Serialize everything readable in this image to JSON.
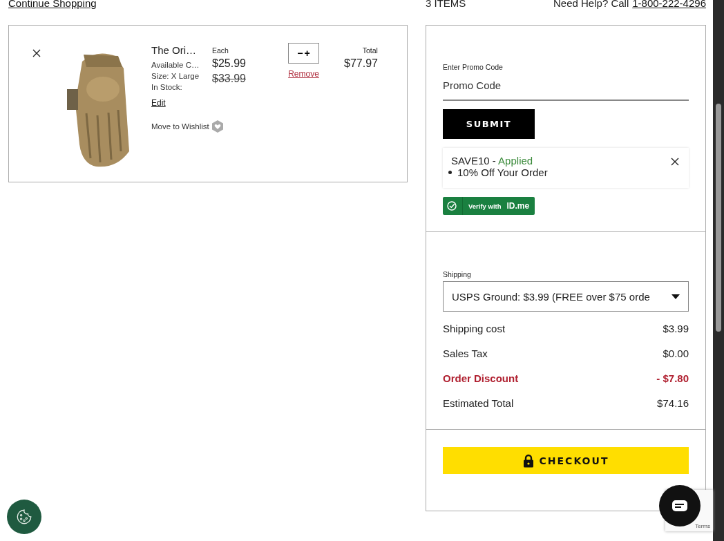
{
  "header": {
    "continue_link": "Continue Shopping",
    "item_count": "3 ITEMS",
    "help_text": "Need Help? Call",
    "phone_link": "1-800-222-4296"
  },
  "cart_items": [
    {
      "name": "The Ori…",
      "available": "Available C…",
      "size": "Size: X Large",
      "stock": "In Stock:",
      "edit": "Edit",
      "wishlist": "Move to Wishlist",
      "each_label": "Each",
      "price": "$25.99",
      "old_price": "$33.99",
      "quantity_minus": "−",
      "quantity_plus": "+",
      "remove": "Remove",
      "total_label": "Total",
      "total": "$77.97"
    }
  ],
  "promo": {
    "label": "Enter Promo Code",
    "placeholder": "Promo Code",
    "submit": "SUBMIT",
    "applied_code": "SAVE10 -",
    "applied_status": "Applied",
    "applied_detail": "10% Off Your Order",
    "verify_text": "Verify with",
    "verify_brand": "ID.me"
  },
  "shipping": {
    "label": "Shipping",
    "selected_option": "USPS Ground: $3.99 (FREE over $75 orde"
  },
  "summary": [
    {
      "label": "Shipping cost",
      "value": "$3.99",
      "kind": "normal"
    },
    {
      "label": "Sales Tax",
      "value": "$0.00",
      "kind": "normal"
    },
    {
      "label": "Order Discount",
      "value": "- $7.80",
      "kind": "discount"
    },
    {
      "label": "Estimated Total",
      "value": "$74.16",
      "kind": "normal"
    }
  ],
  "checkout": "CHECKOUT",
  "recaptcha": "Terms"
}
